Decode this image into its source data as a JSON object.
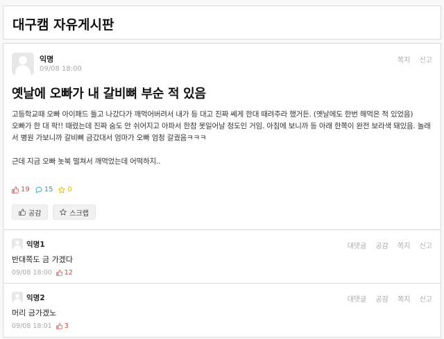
{
  "board": {
    "title": "대구캠 자유게시판"
  },
  "post": {
    "author": "익명",
    "date": "09/08 18:00",
    "actions": [
      "쪽지",
      "신고"
    ],
    "title": "옛날에 오빠가 내 갈비뼈 부순 적 있음",
    "body": [
      "고등학교때 오빠 아이패드 들고 나갔다가 깨먹어버려서 내가 등 대고 진짜 쎄게 한대 때려주라 했거든. (옛날에도 한번 해먹은 적 있었음)",
      "오빠가 한 대 팍!! 때렸는데 진짜 숨도 안 쉬어지고 아파서 한참 못일어날 정도인 거임. 아침에 보니까 등 아래 한쪽이 완전 보라색 돼있음. 놀래서 병원 가보니까 갈비뼈 금갔대서 엄마가 오빠 엄청 갈궜음ㅋㅋㅋ",
      "",
      "근데 지금 오빠 놋북 떨쳐서 깨먹었는데 어떡하지.."
    ],
    "counts": {
      "likes": "19",
      "comments": "15",
      "scraps": "0"
    },
    "buttons": {
      "like": "공감",
      "scrap": "스크랩"
    },
    "icon_color_like": "#e0423a",
    "icon_color_comment": "#17a7b8",
    "icon_color_star": "#e1b400"
  },
  "comments": [
    {
      "author": "익명1",
      "actions": [
        "대댓글",
        "공감",
        "쪽지",
        "신고"
      ],
      "text": "반대쪽도 금 가겠다",
      "date": "09/08 18:00",
      "likes": "12"
    },
    {
      "author": "익명2",
      "actions": [
        "대댓글",
        "공감",
        "쪽지",
        "신고"
      ],
      "text": "머리 금가겠노",
      "date": "09/08 18:01",
      "likes": "3"
    }
  ]
}
